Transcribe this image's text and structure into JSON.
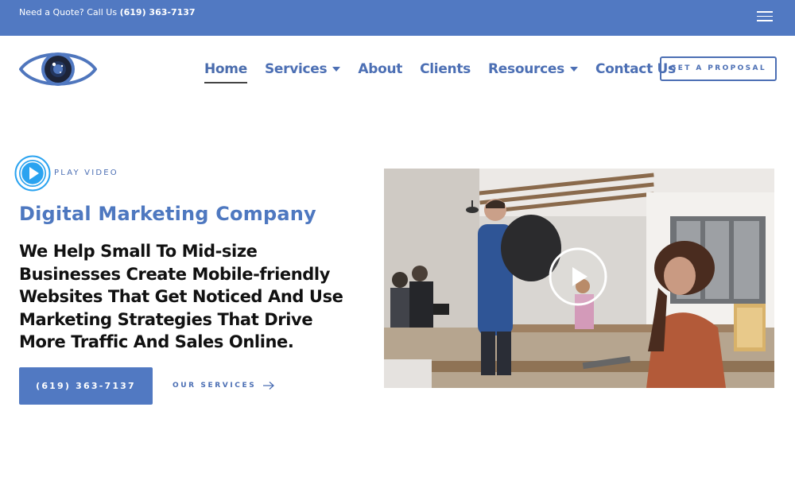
{
  "topbar": {
    "quote_prefix": "Need a Quote? Call Us",
    "quote_phone": "(619) 363-7137"
  },
  "nav": {
    "items": [
      {
        "label": "Home",
        "active": true,
        "dropdown": false
      },
      {
        "label": "Services",
        "active": false,
        "dropdown": true
      },
      {
        "label": "About",
        "active": false,
        "dropdown": false
      },
      {
        "label": "Clients",
        "active": false,
        "dropdown": false
      },
      {
        "label": "Resources",
        "active": false,
        "dropdown": true
      },
      {
        "label": "Contact Us",
        "active": false,
        "dropdown": false
      }
    ],
    "proposal_label": "GET A PROPOSAL"
  },
  "hero": {
    "play_label": "PLAY VIDEO",
    "title": "Digital Marketing Company",
    "subtitle": "We Help Small To Mid-size Businesses Create Mobile-friendly Websites That Get Noticed And Use Marketing Strategies That Drive More Traffic And Sales Online.",
    "phone_button": "(619) 363-7137",
    "services_link": "OUR SERVICES"
  },
  "colors": {
    "brand_blue": "#5179c2",
    "nav_text": "#4c6fb4",
    "heading_text": "#111111"
  },
  "icons": {
    "menu": "hamburger-icon",
    "logo": "eye-logo",
    "play": "play-icon",
    "arrow": "arrow-right-icon"
  }
}
